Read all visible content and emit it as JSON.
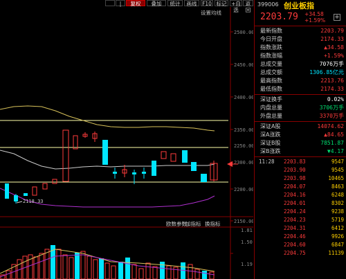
{
  "toolbar": {
    "buttons": [
      "",
      "|",
      "复权",
      "叠加",
      "统计",
      "画线",
      "F10",
      "标记",
      "+自选",
      "返回"
    ],
    "settings_label": "设置均线"
  },
  "main_chart": {
    "price_axis_labels": [
      "2500.00",
      "2450.00",
      "2400.00",
      "2350.00",
      "2300.00",
      "2250.00",
      "2200.00",
      "2150.00"
    ],
    "low_label": "2118.33"
  },
  "indicator_panel": {
    "tabs": [
      "欧数参数",
      "加指标",
      "换指标"
    ],
    "axis_labels": [
      "1.81",
      "1.50",
      "1.19"
    ]
  },
  "quote": {
    "code": "399006",
    "name": "创业板指",
    "price": "2203.79",
    "change": "+34.58",
    "change_pct": "+1.59%",
    "rows": [
      {
        "label": "最新指数",
        "value": "2203.79",
        "color": "#ff3b3b"
      },
      {
        "label": "今日开盘",
        "value": "2174.33",
        "color": "#ff3b3b"
      },
      {
        "label": "指数涨跌",
        "value": "▲34.58",
        "color": "#ff3b3b"
      },
      {
        "label": "指数涨幅",
        "value": "+1.59%",
        "color": "#ff3b3b"
      },
      {
        "label": "总成交量",
        "value": "7076万手",
        "color": "#ffffff"
      },
      {
        "label": "总成交额",
        "value": "1306.85亿元",
        "color": "#00e5ff"
      },
      {
        "label": "最高指数",
        "value": "2213.76",
        "color": "#ff3b3b"
      },
      {
        "label": "最低指数",
        "value": "2174.33",
        "color": "#ff3b3b"
      }
    ],
    "rows2": [
      {
        "label": "深证换手",
        "value": "0.02%",
        "color": "#ffffff"
      },
      {
        "label": "内盘总量",
        "value": "3706万手",
        "color": "#00e070"
      },
      {
        "label": "外盘总量",
        "value": "3370万手",
        "color": "#ff3b3b"
      }
    ],
    "rows3": [
      {
        "label": "深证A股",
        "value": "14074.62",
        "color": "#ff3b3b"
      },
      {
        "label": "深A涨跌",
        "value": "▲84.65",
        "color": "#ff3b3b"
      },
      {
        "label": "深证B股",
        "value": "7851.87",
        "color": "#00e070"
      },
      {
        "label": "深B涨跌",
        "value": "▼4.17",
        "color": "#00e070"
      }
    ],
    "ticks": [
      {
        "time": "11:28",
        "price": "2203.83",
        "vol": "9547"
      },
      {
        "time": "",
        "price": "2203.90",
        "vol": "9545"
      },
      {
        "time": "",
        "price": "2203.98",
        "vol": "10465"
      },
      {
        "time": "",
        "price": "2204.07",
        "vol": "8463"
      },
      {
        "time": "",
        "price": "2204.16",
        "vol": "6248"
      },
      {
        "time": "",
        "price": "2204.01",
        "vol": "8302"
      },
      {
        "time": "",
        "price": "2204.24",
        "vol": "9238"
      },
      {
        "time": "",
        "price": "2204.23",
        "vol": "5719"
      },
      {
        "time": "",
        "price": "2204.31",
        "vol": "6412"
      },
      {
        "time": "",
        "price": "2204.46",
        "vol": "9926"
      },
      {
        "time": "",
        "price": "2204.60",
        "vol": "6847"
      },
      {
        "time": "",
        "price": "2204.75",
        "vol": "11139"
      }
    ]
  },
  "colors": {
    "up": "#ff3b3b",
    "down": "#00e5ff",
    "accent": "#ffd000",
    "border": "#800000"
  }
}
